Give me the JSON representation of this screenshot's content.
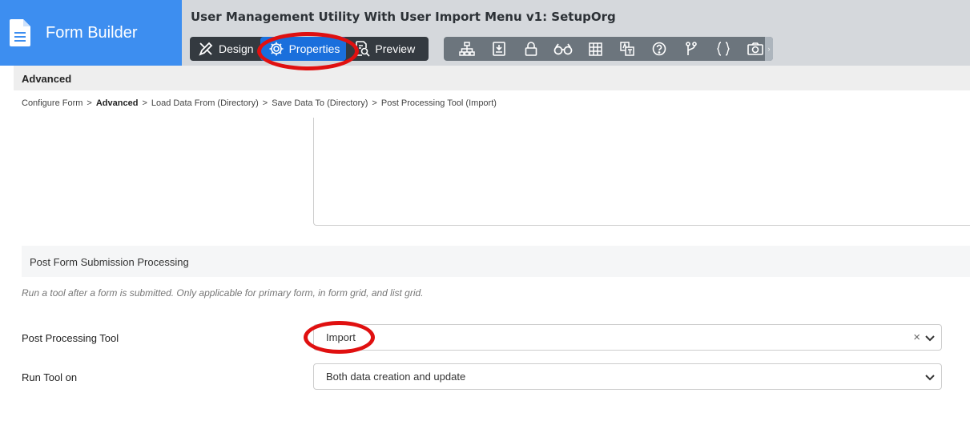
{
  "app": {
    "name": "Form Builder",
    "form_title": "User Management Utility With User Import Menu v1: SetupOrg"
  },
  "tabs": [
    {
      "label": "Design"
    },
    {
      "label": "Properties",
      "active": true
    },
    {
      "label": "Preview"
    }
  ],
  "tool_icons": [
    "sitemap-icon",
    "form-icon",
    "lock-icon",
    "binoculars-icon",
    "grid-icon",
    "translate-icon",
    "help-icon",
    "branch-icon",
    "code-braces-icon",
    "camera-icon"
  ],
  "section": {
    "title": "Advanced"
  },
  "breadcrumb": [
    {
      "label": "Configure Form",
      "bold": false
    },
    {
      "label": "Advanced",
      "bold": true
    },
    {
      "label": "Load Data From (Directory)",
      "bold": false
    },
    {
      "label": "Save Data To (Directory)",
      "bold": false
    },
    {
      "label": "Post Processing Tool (Import)",
      "bold": false
    }
  ],
  "post_submission": {
    "title": "Post Form Submission Processing",
    "hint": "Run a tool after a form is submitted. Only applicable for primary form, in form grid, and list grid.",
    "tool_label": "Post Processing Tool",
    "tool_value": "Import",
    "clear_symbol": "×",
    "run_label": "Run Tool on",
    "run_value": "Both data creation and update"
  },
  "colors": {
    "brand": "#3d8ef0",
    "active_tab": "#1a6fdc",
    "annotation": "#e01010"
  }
}
